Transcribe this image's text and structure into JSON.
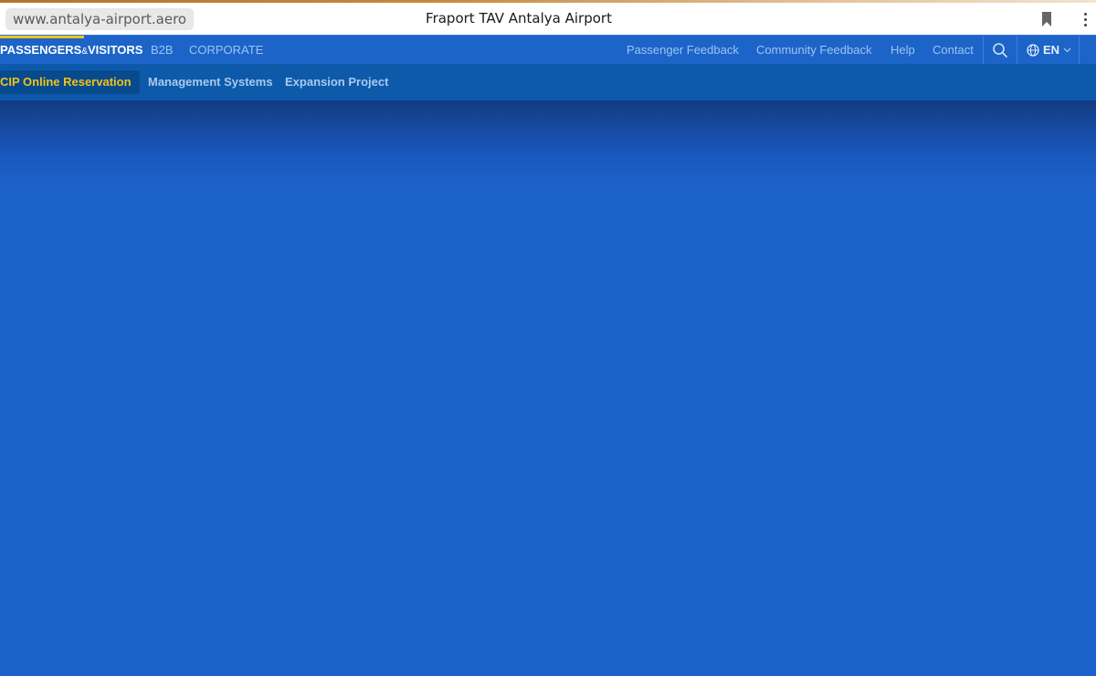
{
  "browser": {
    "url": "www.antalya-airport.aero",
    "title": "Fraport TAV Antalya Airport",
    "icons": {
      "bookmark": "bookmark-icon",
      "menu": "vertical-ellipsis-icon"
    }
  },
  "nav_primary": {
    "passengers_main": "PASSENGERS",
    "passengers_amp": "&",
    "passengers_tail": "VISITORS",
    "b2b": "B2B",
    "corporate": "CORPORATE",
    "passenger_feedback": "Passenger Feedback",
    "community_feedback": "Community Feedback",
    "help": "Help",
    "contact": "Contact",
    "language": "EN",
    "icons": {
      "search": "search-icon",
      "globe": "globe-icon",
      "chevron": "chevron-down-icon"
    }
  },
  "nav_secondary": {
    "cip": "CIP Online Reservation",
    "management": "Management Systems",
    "expansion": "Expansion Project"
  },
  "colors": {
    "accent": "#f0c419",
    "nav_primary_bg": "#1c64c8",
    "nav_secondary_bg": "#0d5aaa",
    "hero_bg": "#1c62cb"
  }
}
